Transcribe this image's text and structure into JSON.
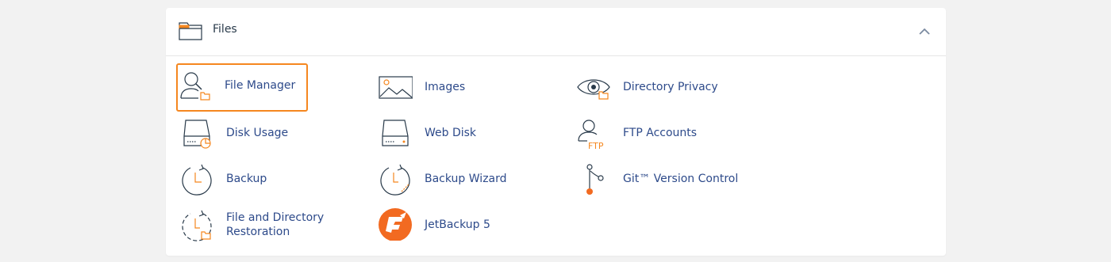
{
  "section": {
    "title": "Files",
    "header_icon": "folder-icon",
    "collapse_icon": "chevron-up-icon"
  },
  "colors": {
    "accent": "#f5871f",
    "link": "#2d4a8a",
    "icon_stroke": "#293a4a",
    "jetbackup": "#f26a21"
  },
  "items": [
    {
      "label": "File Manager",
      "icon": "file-manager-icon",
      "selected": true
    },
    {
      "label": "Images",
      "icon": "images-icon"
    },
    {
      "label": "Directory Privacy",
      "icon": "directory-privacy-icon"
    },
    {
      "label": "Disk Usage",
      "icon": "disk-usage-icon"
    },
    {
      "label": "Web Disk",
      "icon": "web-disk-icon"
    },
    {
      "label": "FTP Accounts",
      "icon": "ftp-accounts-icon",
      "icon_text": "FTP"
    },
    {
      "label": "Backup",
      "icon": "backup-icon"
    },
    {
      "label": "Backup Wizard",
      "icon": "backup-wizard-icon"
    },
    {
      "label": "Git™ Version Control",
      "icon": "git-icon"
    },
    {
      "label": "File and Directory Restoration",
      "icon": "file-restoration-icon"
    },
    {
      "label": "JetBackup 5",
      "icon": "jetbackup-icon"
    }
  ]
}
